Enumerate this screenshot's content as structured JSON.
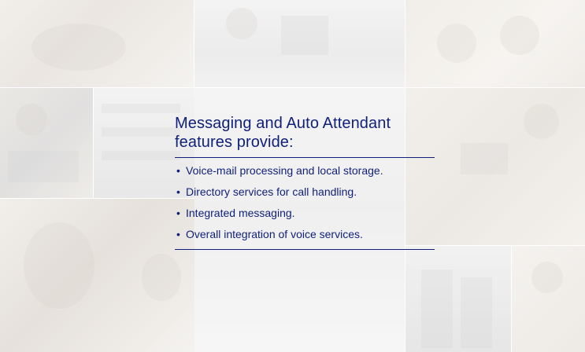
{
  "slide": {
    "title_line1": "Messaging and Auto Attendant",
    "title_line2": "features provide:",
    "bullets": [
      "Voice-mail processing and local storage.",
      "Directory services for call handling.",
      "Integrated messaging.",
      "Overall integration of voice services."
    ],
    "bullet_symbol": "•",
    "text_color": "#0f1f7a",
    "background_images": [
      "handshake-photo",
      "office-worker-at-computer-photo",
      "meeting-photo",
      "colleagues-at-desk-photo",
      "server-equipment-photo",
      "woman-on-laptop-photo",
      "smiling-woman-photo",
      "network-racks-photo",
      "woman-at-desk-photo"
    ]
  }
}
